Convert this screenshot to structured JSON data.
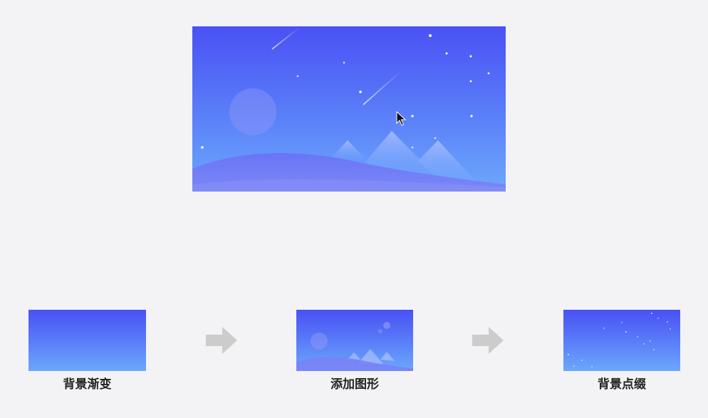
{
  "steps": [
    {
      "label": "背景渐变"
    },
    {
      "label": "添加图形"
    },
    {
      "label": "背景点缀"
    }
  ],
  "colors": {
    "page_background": "#f3f3f6",
    "gradient_top": "#4a51f4",
    "gradient_bottom": "#6ca8fb",
    "arrow": "#cccccc",
    "label_text": "#222222"
  },
  "icons": {
    "arrow": "right-arrow-icon",
    "cursor": "mouse-pointer-icon"
  }
}
